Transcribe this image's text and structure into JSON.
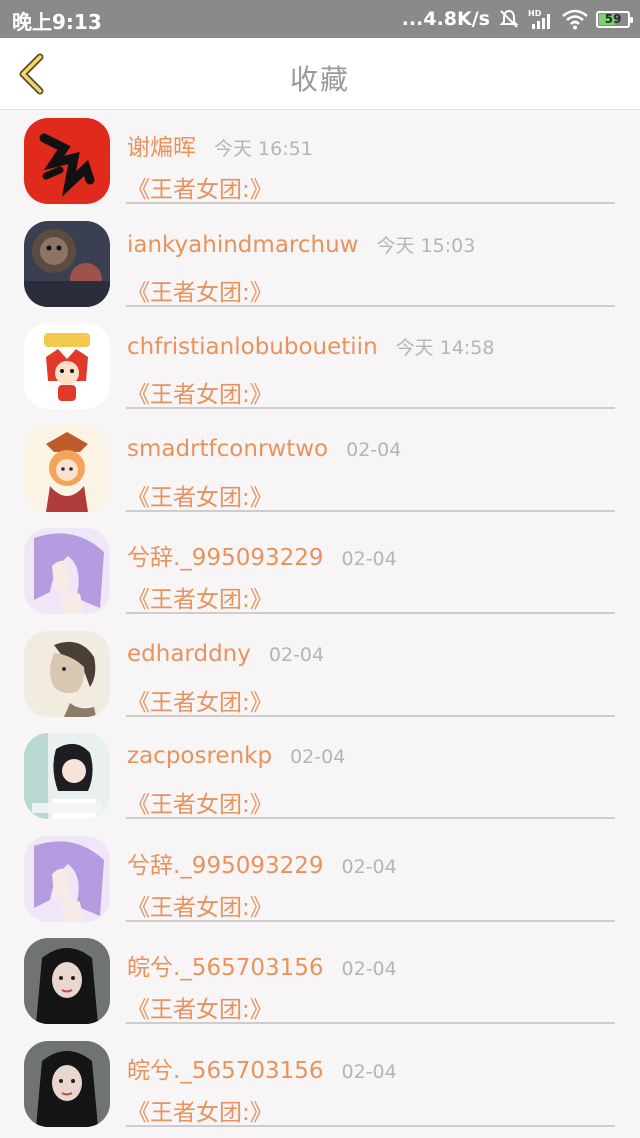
{
  "status_bar": {
    "time": "晚上9:13",
    "network_speed": "...4.8K/s",
    "battery_level": "59",
    "icons": [
      "mute-bell-icon",
      "hd-signal-icon",
      "wifi-icon",
      "battery-icon"
    ],
    "battery_color": "#7bd36d"
  },
  "header": {
    "title": "收藏",
    "back_icon": "chevron-left-icon",
    "accent_color": "#e8935e"
  },
  "items": [
    {
      "name": "谢煸晖",
      "time": "今天 16:51",
      "message": "《王者女团:》",
      "avatar": "red-calligraphy-avatar"
    },
    {
      "name": "iankyahindmarchuw",
      "time": "今天 15:03",
      "message": "《王者女团:》",
      "avatar": "monkey-photo-avatar"
    },
    {
      "name": "chfristianlobubouetiin",
      "time": "今天 14:58",
      "message": "《王者女团:》",
      "avatar": "cartoon-fox-avatar"
    },
    {
      "name": "smadrtfconrwtwo",
      "time": "02-04",
      "message": "《王者女团:》",
      "avatar": "anime-girl-avatar"
    },
    {
      "name": "兮辞._995093229",
      "time": "02-04",
      "message": "《王者女团:》",
      "avatar": "purple-hair-avatar"
    },
    {
      "name": "edharddny",
      "time": "02-04",
      "message": "《王者女团:》",
      "avatar": "sketch-portrait-avatar"
    },
    {
      "name": "zacposrenkp",
      "time": "02-04",
      "message": "《王者女团:》",
      "avatar": "girl-photo-avatar"
    },
    {
      "name": "兮辞._995093229",
      "time": "02-04",
      "message": "《王者女团:》",
      "avatar": "purple-hair-avatar"
    },
    {
      "name": "皖兮._565703156",
      "time": "02-04",
      "message": "《王者女团:》",
      "avatar": "dark-hair-girl-avatar"
    },
    {
      "name": "皖兮._565703156",
      "time": "02-04",
      "message": "《王者女团:》",
      "avatar": "dark-hair-girl-avatar"
    }
  ]
}
